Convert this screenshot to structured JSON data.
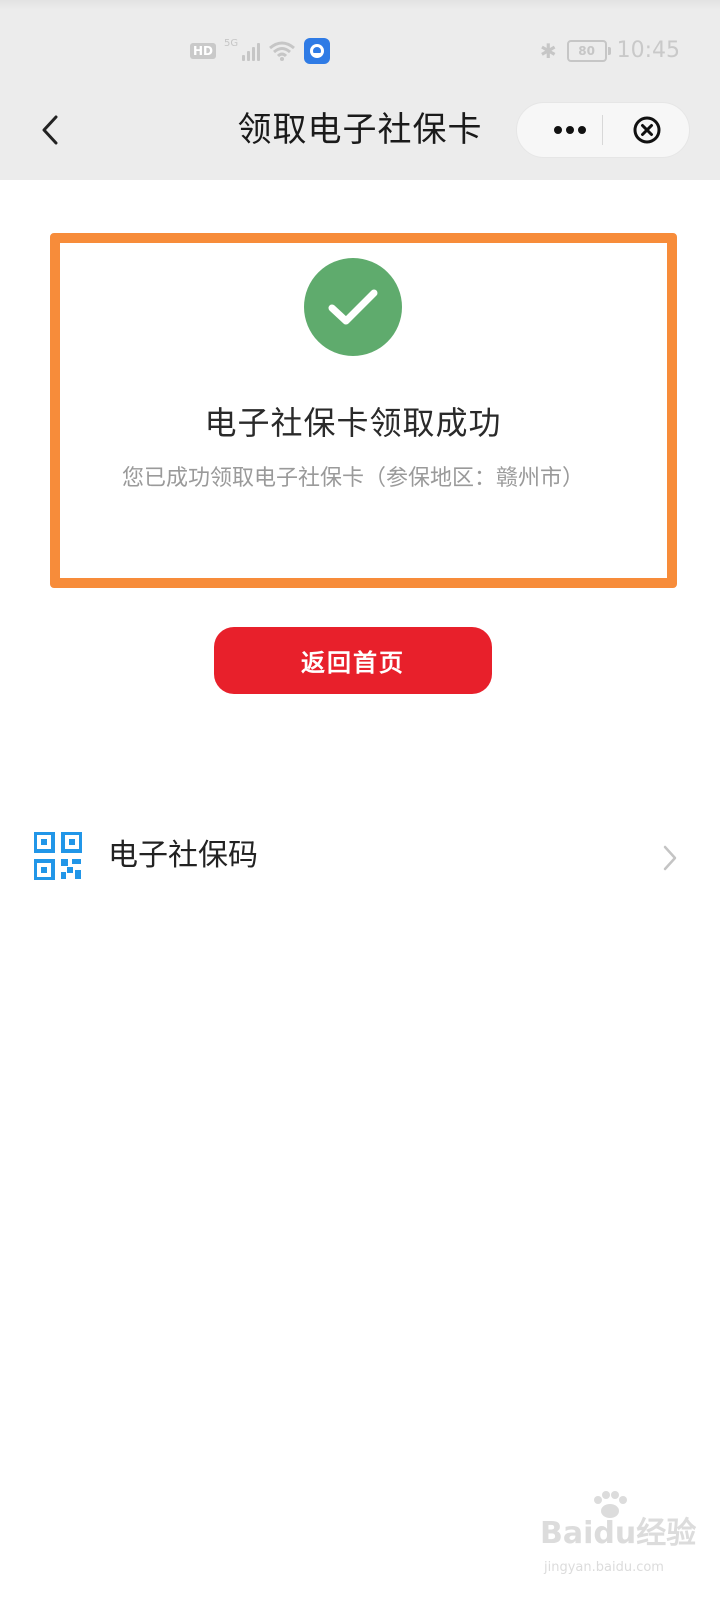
{
  "status_bar": {
    "hd_label": "HD",
    "network_label": "5G",
    "battery": "80",
    "time": "10:45"
  },
  "nav": {
    "title": "领取电子社保卡"
  },
  "success": {
    "title": "电子社保卡领取成功",
    "description": "您已成功领取电子社保卡（参保地区：赣州市）"
  },
  "actions": {
    "home_label": "返回首页"
  },
  "list": {
    "items": [
      {
        "label": "电子社保码",
        "icon": "qr-code-icon"
      }
    ]
  },
  "colors": {
    "accent_red": "#e8202b",
    "success_green": "#5fab6d",
    "highlight_orange": "#f78c3a",
    "qr_blue": "#2196e8"
  },
  "watermark": {
    "brand": "Baidu经验",
    "url": "jingyan.baidu.com"
  }
}
